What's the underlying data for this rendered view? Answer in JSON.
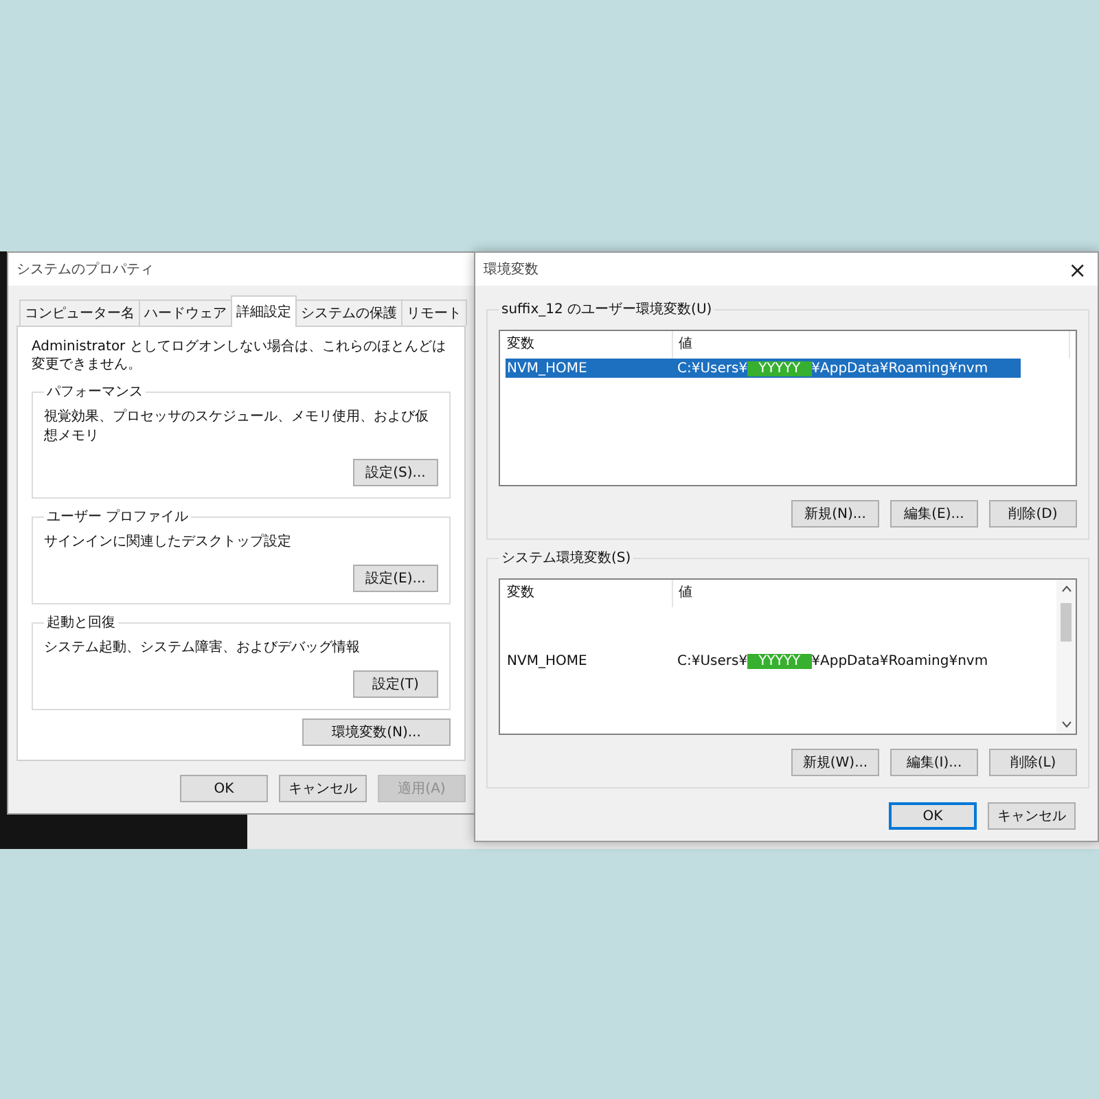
{
  "system_properties": {
    "title": "システムのプロパティ",
    "tabs": [
      {
        "label": "コンピューター名",
        "selected": false
      },
      {
        "label": "ハードウェア",
        "selected": false
      },
      {
        "label": "詳細設定",
        "selected": true
      },
      {
        "label": "システムの保護",
        "selected": false
      },
      {
        "label": "リモート",
        "selected": false
      }
    ],
    "notice": "Administrator としてログオンしない場合は、これらのほとんどは変更できません。",
    "groups": [
      {
        "title": "パフォーマンス",
        "description": "視覚効果、プロセッサのスケジュール、メモリ使用、および仮想メモリ",
        "button": "設定(S)..."
      },
      {
        "title": "ユーザー プロファイル",
        "description": "サインインに関連したデスクトップ設定",
        "button": "設定(E)..."
      },
      {
        "title": "起動と回復",
        "description": "システム起動、システム障害、およびデバッグ情報",
        "button": "設定(T)"
      }
    ],
    "env_button": "環境変数(N)...",
    "buttons": [
      {
        "label": "OK",
        "disabled": false
      },
      {
        "label": "キャンセル",
        "disabled": false
      },
      {
        "label": "適用(A)",
        "disabled": true
      }
    ]
  },
  "environment_variables": {
    "title": "環境変数",
    "close": "×",
    "sections": [
      {
        "title": "suffix_12 のユーザー環境変数(U)",
        "columns": [
          "変数",
          "値"
        ],
        "rows": [
          {
            "name": "NVM_HOME",
            "value_before": "C:¥Users¥",
            "value_masked": "YYYYY",
            "value_after": "¥AppData¥Roaming¥nvm",
            "selected": true
          }
        ],
        "buttons": [
          "新規(N)...",
          "編集(E)...",
          "削除(D)"
        ]
      },
      {
        "title": "システム環境変数(S)",
        "columns": [
          "変数",
          "値"
        ],
        "rows": [
          {
            "name": "NVM_HOME",
            "value_before": "C:¥Users¥",
            "value_masked": "YYYYY",
            "value_after": "¥AppData¥Roaming¥nvm",
            "selected": false
          }
        ],
        "buttons": [
          "新規(W)...",
          "編集(I)...",
          "削除(L)"
        ]
      }
    ],
    "buttons": [
      {
        "label": "OK",
        "default": true
      },
      {
        "label": "キャンセル",
        "default": false
      }
    ]
  }
}
